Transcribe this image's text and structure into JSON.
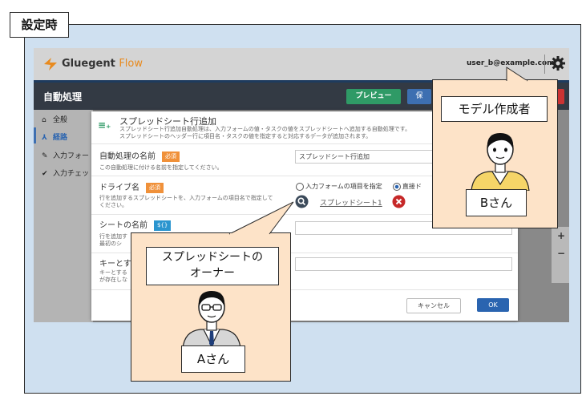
{
  "setting_label": "設定時",
  "app": {
    "brand_name": "Gluegent",
    "brand_suffix": "Flow",
    "user_email": "user_b@example.com",
    "page_title": "自動処理",
    "toolbar": {
      "preview_label": "プレビュー",
      "save_label": "保"
    }
  },
  "sidebar": {
    "items": [
      {
        "label": "全般",
        "icon": "home-icon"
      },
      {
        "label": "経路",
        "icon": "route-icon"
      },
      {
        "label": "入力フォー",
        "icon": "pencil-icon"
      },
      {
        "label": "入力チェッ",
        "icon": "check-icon"
      }
    ]
  },
  "dialog": {
    "title": "スプレッドシート行追加",
    "description_1": "スプレッドシート行追加自動処理は、入力フォームの値・タスクの値をスプレッドシートへ追加する自動処理です。",
    "description_2": "スプレッドシートのヘッダー行に項目名・タスクの値を指定すると対応するデータが追加されます。",
    "name_section": {
      "label": "自動処理の名前",
      "badge": "必須",
      "help": "この自動処理に付ける名前を指定してください。",
      "value": "スプレッドシート行追加"
    },
    "drive_section": {
      "label": "ドライブ名",
      "badge": "必須",
      "help_1": "行を追加するスプレッドシートを、入力フォームの項目名で指定して",
      "help_2": "ください。",
      "radio_form": "入力フォームの項目を指定",
      "radio_direct": "直接ド",
      "sheet_link": "スプレッドシート1"
    },
    "sheet_section": {
      "label": "シートの名前",
      "badge": "${}",
      "help_1": "行を追加す",
      "help_2": "最初のシ"
    },
    "key_section": {
      "label": "キーとす",
      "help_1": "キーとする",
      "help_2": "が存在しな"
    },
    "cancel_label": "キャンセル",
    "ok_label": "OK"
  },
  "callout_creator": {
    "role": "モデル作成者",
    "person": "Bさん"
  },
  "callout_owner": {
    "role_line1": "スプレッドシートの",
    "role_line2": "オーナー",
    "person": "Aさん"
  },
  "colors": {
    "frame_bg": "#cfe0f0",
    "callout_bg": "#fde3c8",
    "accent_orange": "#e88a1e",
    "accent_green": "#2f9a66",
    "accent_blue": "#2a64b0",
    "badge_orange": "#f0913a"
  }
}
